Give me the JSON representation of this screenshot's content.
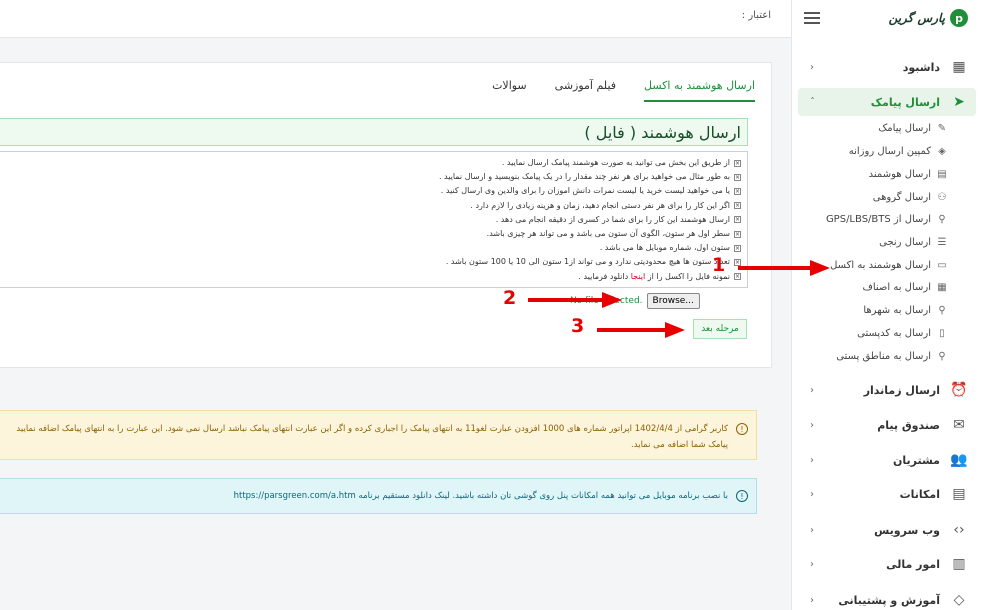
{
  "sidebar": {
    "logo_text": "پارس گرین",
    "logo_glyph": "p",
    "menu": [
      {
        "label": "داشبود",
        "icon": "▦",
        "chev": "‹"
      },
      {
        "label": "ارسال پیامک",
        "icon": "➤",
        "chev": "ˆ"
      },
      {
        "label": "ارسال زماندار",
        "icon": "⏰",
        "chev": "‹"
      },
      {
        "label": "صندوق پیام",
        "icon": "✉",
        "chev": "‹"
      },
      {
        "label": "مشتریان",
        "icon": "👥",
        "chev": "‹"
      },
      {
        "label": "امکانات",
        "icon": "▤",
        "chev": "‹"
      },
      {
        "label": "وب سرویس",
        "icon": "‹›",
        "chev": "‹"
      },
      {
        "label": "امور مالی",
        "icon": "▥",
        "chev": "‹"
      },
      {
        "label": "آموزش و پشتیبانی",
        "icon": "◇",
        "chev": "‹"
      }
    ],
    "submenu": [
      {
        "label": "ارسال پیامک",
        "icon": "✎"
      },
      {
        "label": "کمپین ارسال روزانه",
        "icon": "◈"
      },
      {
        "label": "ارسال هوشمند",
        "icon": "▤"
      },
      {
        "label": "ارسال گروهی",
        "icon": "⚇"
      },
      {
        "label": "ارسال از GPS/LBS/BTS",
        "icon": "⚲"
      },
      {
        "label": "ارسال رنجی",
        "icon": "☰"
      },
      {
        "label": "ارسال هوشمند به اکسل",
        "icon": "▭"
      },
      {
        "label": "ارسال به اصناف",
        "icon": "▦"
      },
      {
        "label": "ارسال به شهرها",
        "icon": "⚲"
      },
      {
        "label": "ارسال به کدپستی",
        "icon": "▯"
      },
      {
        "label": "ارسال به مناطق پستی",
        "icon": "⚲"
      }
    ]
  },
  "topbar": {
    "credit": "اعتبار :"
  },
  "tabs": [
    {
      "label": "ارسال هوشمند به اکسل"
    },
    {
      "label": "فیلم آموزشی"
    },
    {
      "label": "سوالات"
    }
  ],
  "page_title": "ارسال هوشمند ( فایل )",
  "info_lines": [
    "از طریق این بخش می توانید به صورت هوشمند پیامک ارسال نمایید .",
    "به طور مثال می خواهید برای هر نفر چند مقدار را در یک پیامک بنویسید و ارسال نمایید .",
    "یا می خواهید لیست خرید یا لیست نمرات دانش اموزان را برای والدین وی ارسال کنید .",
    "اگر این کار را برای هر نفر دستی انجام دهید، زمان و هزینه زیادی را لازم دارد .",
    "ارسال هوشمند این کار را برای شما در کسری از دقیقه انجام می دهد .",
    "سطر اول هر ستون، الگوی آن ستون می باشد و می تواند هر چیزی باشد.",
    "ستون اول، شماره موبایل ها می باشد .",
    "تعداد ستون ها هیچ محدودیتی ندارد و می تواند از1 ستون الی 10 یا 100 ستون باشد ."
  ],
  "sample_line": {
    "before": "نمونه فایل را اکسل را از",
    "link": "اینجا",
    "after": "دانلود فرمایید ."
  },
  "checkbox_glyph": "×",
  "file": {
    "status": "No file selected.",
    "browse_label": "Browse..."
  },
  "next_button": "مرحله بعد",
  "alerts": {
    "warning_line1": "کاربر گرامی از 1402/4/4 اپراتور شماره های 1000 افزودن عبارت لغو11 به انتهای پیامک را اجباری کرده و اگر این عبارت انتهای پیامک نباشد ارسال نمی شود. این عبارت را به انتهای پیامک اضافه نمایید",
    "warning_line2": "پیامک شما اضافه می نماید.",
    "info": "با نصب برنامه موبایل می توانید همه امکانات پنل روی گوشی تان داشته باشید. لینک دانلود مستقیم برنامه https://parsgreen.com/a.htm",
    "icon_glyph": "!"
  },
  "annotations": [
    "1",
    "2",
    "3"
  ],
  "colors": {
    "accent": "#1f8f3a",
    "annotation": "#e60000"
  }
}
